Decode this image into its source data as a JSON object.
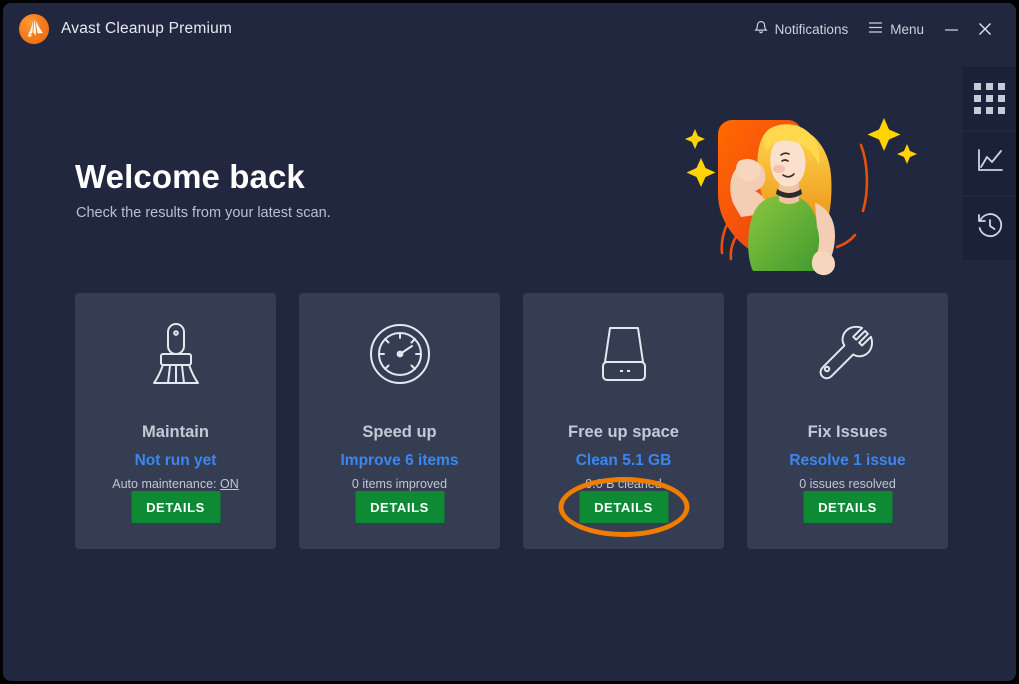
{
  "window": {
    "app_title": "Avast Cleanup Premium",
    "logo_icon": "avast-logo-icon",
    "accent_orange": "#f07d00",
    "accent_green": "#0e8a35",
    "accent_blue": "#3d86f0",
    "bg": "#20273e",
    "card_bg": "#343d52"
  },
  "titlebar": {
    "notifications_label": "Notifications",
    "notifications_icon": "bell-icon",
    "menu_label": "Menu",
    "menu_icon": "hamburger-icon",
    "minimize_icon": "minimize-icon",
    "close_icon": "close-icon"
  },
  "hero": {
    "title": "Welcome back",
    "subtitle": "Check the results from your latest scan.",
    "illustration": "flexing-woman-shield-illustration"
  },
  "cards": [
    {
      "icon": "broom-icon",
      "title": "Maintain",
      "action": "Not run yet",
      "sub_prefix": "Auto maintenance: ",
      "sub_value": "ON",
      "button": "DETAILS",
      "highlighted": false
    },
    {
      "icon": "speedometer-icon",
      "title": "Speed up",
      "action": "Improve 6 items",
      "sub_prefix": "0 items improved",
      "sub_value": "",
      "button": "DETAILS",
      "highlighted": false
    },
    {
      "icon": "hard-drive-icon",
      "title": "Free up space",
      "action": "Clean 5.1 GB",
      "sub_prefix": "0.0 B cleaned",
      "sub_value": "",
      "button": "DETAILS",
      "highlighted": true
    },
    {
      "icon": "wrench-icon",
      "title": "Fix Issues",
      "action": "Resolve 1 issue",
      "sub_prefix": "0 issues resolved",
      "sub_value": "",
      "button": "DETAILS",
      "highlighted": false
    }
  ],
  "right_rail": [
    {
      "icon": "grid-apps-icon"
    },
    {
      "icon": "line-chart-icon"
    },
    {
      "icon": "history-clock-icon"
    }
  ]
}
